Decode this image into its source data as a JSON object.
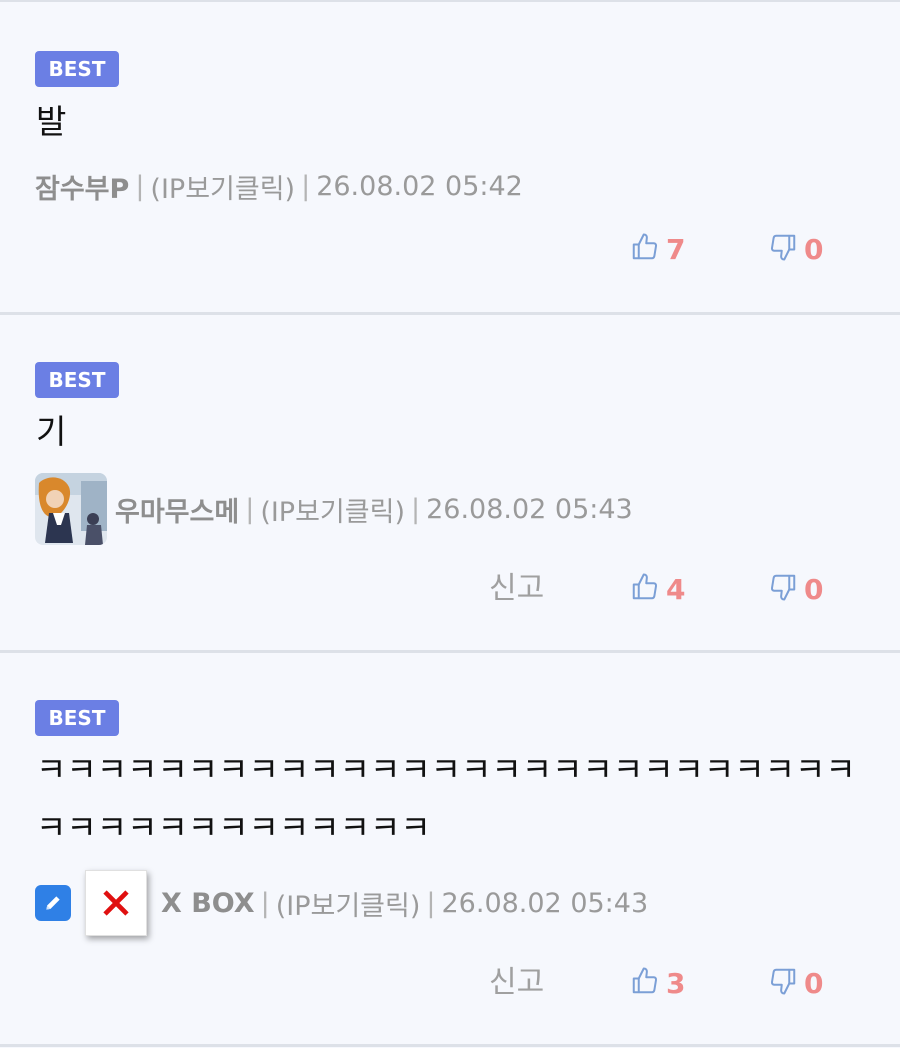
{
  "colors": {
    "badge": "#6b7fe4",
    "vote_count": "#ef8a8a",
    "thumb_icon": "#7b9fd6",
    "edit_badge": "#2f80e6",
    "x_mark": "#e01010"
  },
  "comments": [
    {
      "badge": "BEST",
      "text": "발",
      "author": "잠수부P",
      "ip": "(IP보기클릭)",
      "datetime": "26.08.02 05:42",
      "likes": "7",
      "dislikes": "0"
    },
    {
      "badge": "BEST",
      "text": "기",
      "author": "우마무스메",
      "ip": "(IP보기클릭)",
      "datetime": "26.08.02 05:43",
      "report": "신고",
      "likes": "4",
      "dislikes": "0"
    },
    {
      "badge": "BEST",
      "text": "ㅋㅋㅋㅋㅋㅋㅋㅋㅋㅋㅋㅋㅋㅋㅋㅋㅋㅋㅋㅋㅋㅋㅋㅋㅋㅋㅋㅋㅋㅋㅋㅋㅋㅋㅋㅋㅋㅋㅋㅋ",
      "author": "X BOX",
      "ip": "(IP보기클릭)",
      "datetime": "26.08.02 05:43",
      "report": "신고",
      "likes": "3",
      "dislikes": "0"
    }
  ],
  "separator": "|",
  "icons": [
    "thumbs-up-icon",
    "thumbs-down-icon",
    "pencil-icon",
    "broken-image-x-icon"
  ]
}
